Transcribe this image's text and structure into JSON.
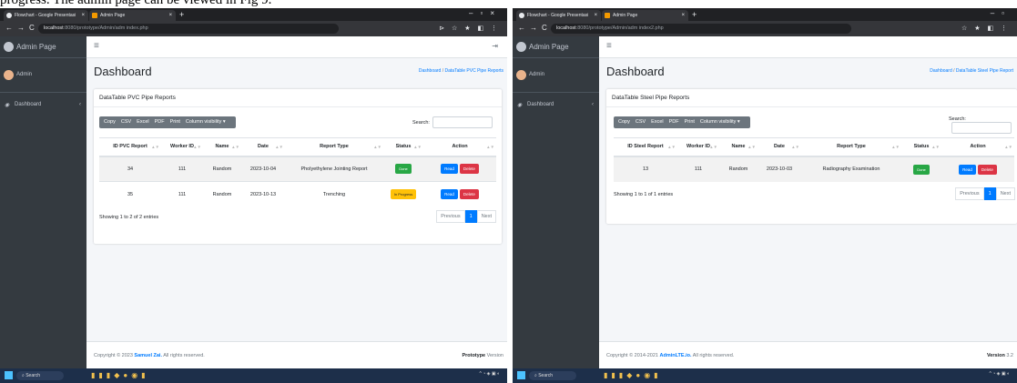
{
  "caption": "progress. The admin page can be viewed in Fig 9.",
  "screens": [
    {
      "tab1": "Flowchart - Google Presentasi",
      "tab2": "Admin Page",
      "url_host": "localhost",
      "url_path": ":8080/prototype/Admin/adm index.php",
      "brand": "Admin Page",
      "user": "Admin",
      "menu": "Dashboard",
      "page_title": "Dashboard",
      "breadcrumb_home": "Dashboard",
      "breadcrumb_sep": "/",
      "breadcrumb_current": "DataTable PVC Pipe Reports",
      "card_title": "DataTable PVC Pipe Reports",
      "export_buttons": [
        "Copy",
        "CSV",
        "Excel",
        "PDF",
        "Print",
        "Column visibility ▾"
      ],
      "search_label": "Search:",
      "columns": [
        "ID PVC Report",
        "Worker ID",
        "Name",
        "Date",
        "Report Type",
        "Status",
        "Action"
      ],
      "rows": [
        {
          "id": "34",
          "worker": "111",
          "name": "Random",
          "date": "2023-10-04",
          "type": "Pholyethylene Jointing Report",
          "status": "Done"
        },
        {
          "id": "35",
          "worker": "111",
          "name": "Random",
          "date": "2023-10-13",
          "type": "Trenching",
          "status": "In Progress"
        }
      ],
      "read_label": "Read",
      "delete_label": "Delete",
      "info": "Showing 1 to 2 of 2 entries",
      "prev": "Previous",
      "page": "1",
      "next": "Next",
      "footer_prefix": "Copyright © 2023",
      "footer_link": "Samuel Zai.",
      "footer_suffix": "All rights reserved.",
      "version_label": "Prototype",
      "version_value": "Version",
      "search_taskbar": "Search"
    },
    {
      "tab1": "Flowchart - Google Presentasi",
      "tab2": "Admin Page",
      "url_host": "localhost",
      "url_path": ":8080/prototype/Admin/adm index2.php",
      "brand": "Admin Page",
      "user": "Admin",
      "menu": "Dashboard",
      "page_title": "Dashboard",
      "breadcrumb_home": "Dashboard",
      "breadcrumb_sep": "/",
      "breadcrumb_current": "DataTable Steel Pipe Report",
      "card_title": "DataTable Steel Pipe Reports",
      "export_buttons": [
        "Copy",
        "CSV",
        "Excel",
        "PDF",
        "Print",
        "Column visibility ▾"
      ],
      "search_label": "Search:",
      "columns": [
        "ID Steel Report",
        "Worker ID",
        "Name",
        "Date",
        "Report Type",
        "Status",
        "Action"
      ],
      "rows": [
        {
          "id": "13",
          "worker": "111",
          "name": "Random",
          "date": "2023-10-03",
          "type": "Radiography Examination",
          "status": "Done"
        }
      ],
      "read_label": "Read",
      "delete_label": "Delete",
      "info": "Showing 1 to 1 of 1 entries",
      "prev": "Previous",
      "page": "1",
      "next": "Next",
      "footer_prefix": "Copyright © 2014-2021",
      "footer_link": "AdminLTE.io.",
      "footer_suffix": "All rights reserved.",
      "version_label": "Version",
      "version_value": "3.2",
      "search_taskbar": "Search"
    }
  ]
}
